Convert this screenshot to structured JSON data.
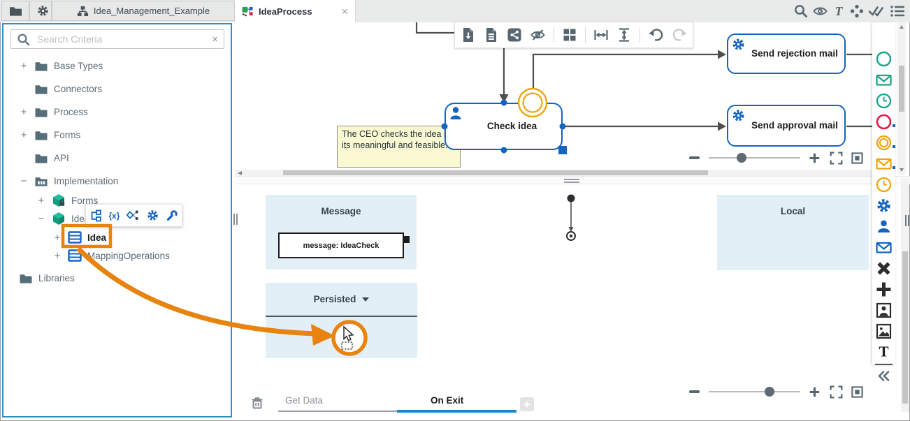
{
  "header": {
    "project_tab_label": "Idea_Management_Example"
  },
  "doc_tab": {
    "label": "IdeaProcess",
    "close_glyph": "×"
  },
  "sidebar": {
    "search": {
      "placeholder": "Search Criteria",
      "clear_glyph": "×"
    },
    "mini_toolbar": {
      "braces_label": "{x}"
    },
    "tree": [
      {
        "expander": "+",
        "icon": "folder",
        "label": "Base Types"
      },
      {
        "expander": "",
        "icon": "folder",
        "label": "Connectors"
      },
      {
        "expander": "+",
        "icon": "folder",
        "label": "Process"
      },
      {
        "expander": "+",
        "icon": "folder",
        "label": "Forms"
      },
      {
        "expander": "",
        "icon": "folder",
        "label": "API"
      },
      {
        "expander": "−",
        "icon": "implementation-folder",
        "label": "Implementation"
      },
      {
        "expander": "+",
        "icon": "locked-cube",
        "label": "Forms"
      },
      {
        "expander": "−",
        "icon": "cube",
        "label": "Idea"
      },
      {
        "expander": "+",
        "icon": "entity",
        "label": "Idea"
      },
      {
        "expander": "+",
        "icon": "entity",
        "label": "MappingOperations"
      },
      {
        "expander": "",
        "icon": "folder",
        "label": "Libraries"
      }
    ]
  },
  "process_diagram": {
    "tasks": {
      "check_idea": "Check idea",
      "send_rejection": "Send rejection mail",
      "send_approval": "Send approval mail"
    },
    "note": "The CEO checks the idea if its meaningful and feasible."
  },
  "data_diagram": {
    "message_group_title": "Message",
    "message_entry": "message: IdeaCheck",
    "persisted_group_title": "Persisted",
    "local_group_title": "Local"
  },
  "bottom_bar": {
    "tab_get_data": "Get Data",
    "tab_on_exit": "On Exit",
    "add_glyph": "+"
  },
  "colors": {
    "accent_blue": "#1565c0",
    "panel_border_blue": "#2a93c6",
    "annotation_orange": "#e8830f",
    "note_yellow": "#fbf9d2",
    "group_fill_blue": "#e2eff7",
    "palette_green": "#17a689",
    "palette_red": "#e5194a",
    "palette_orange": "#f0a50f",
    "active_tab_underline": "#1e88c7"
  }
}
